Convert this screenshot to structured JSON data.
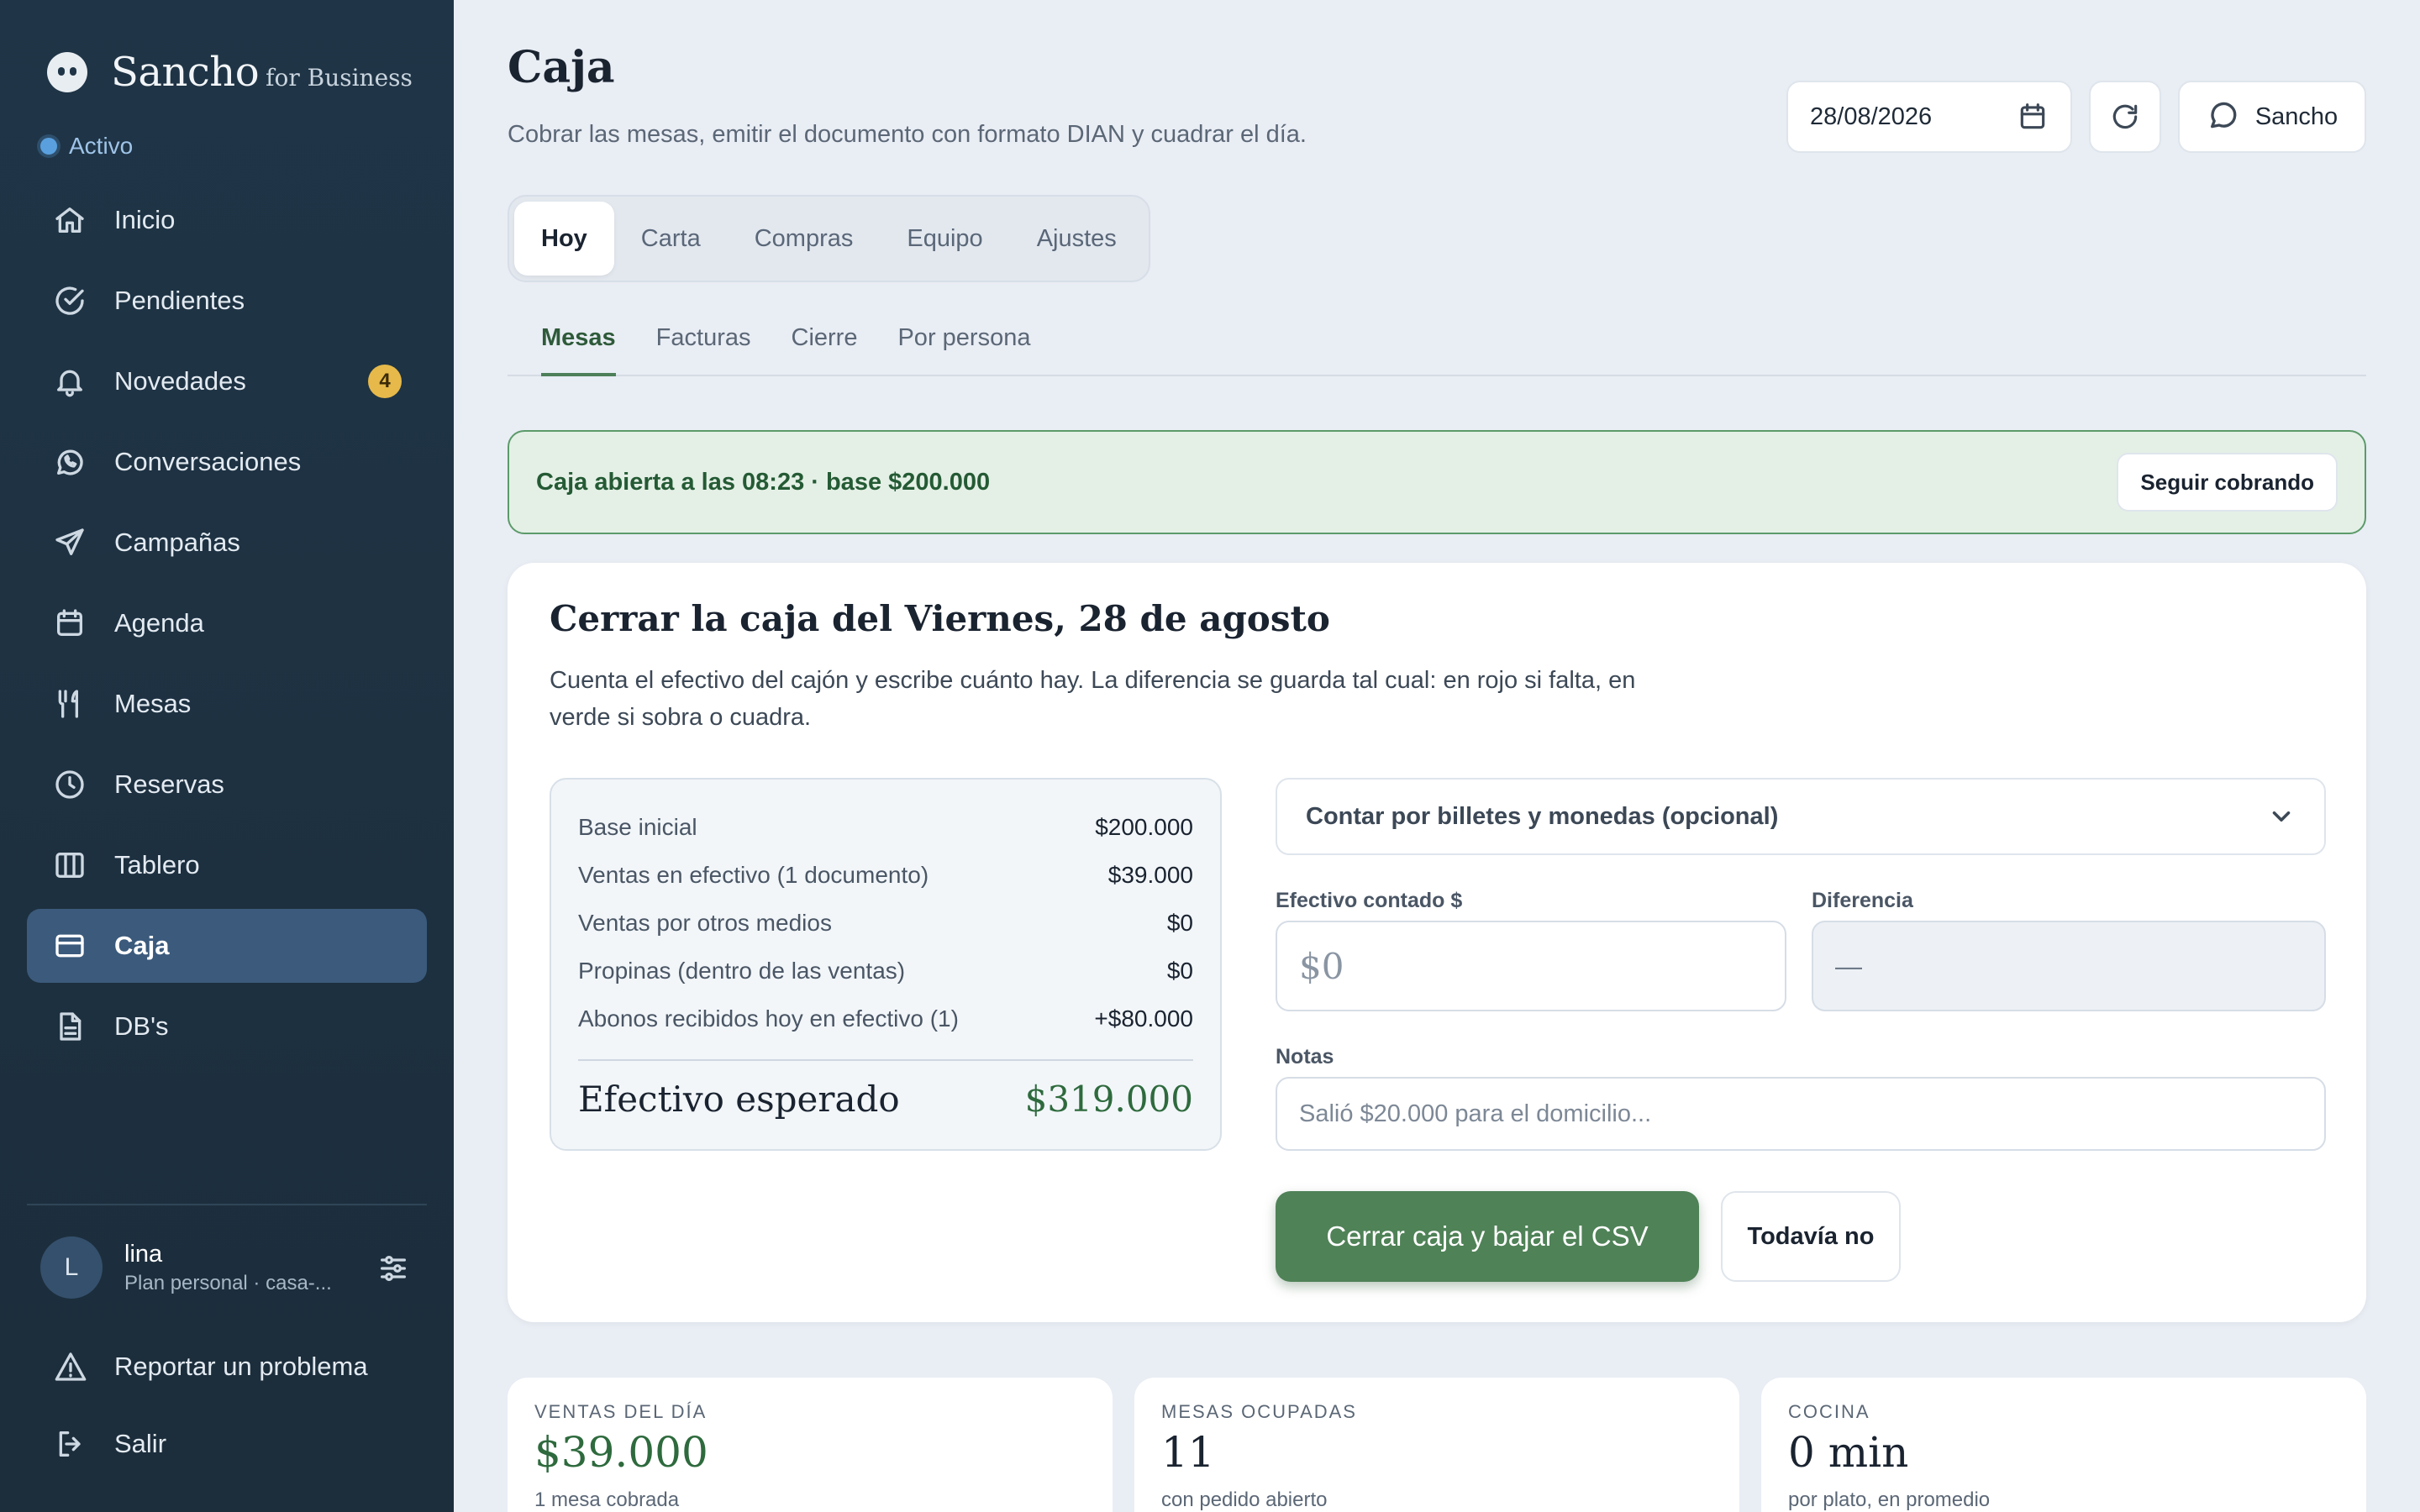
{
  "brand": {
    "name": "Sancho",
    "sub": "for Business",
    "status": "Activo"
  },
  "sidebar": {
    "items": [
      {
        "label": "Inicio",
        "icon": "home-icon"
      },
      {
        "label": "Pendientes",
        "icon": "check-circle-icon"
      },
      {
        "label": "Novedades",
        "icon": "bell-icon",
        "badge": "4"
      },
      {
        "label": "Conversaciones",
        "icon": "whatsapp-icon"
      },
      {
        "label": "Campañas",
        "icon": "send-icon"
      },
      {
        "label": "Agenda",
        "icon": "calendar-icon"
      },
      {
        "label": "Mesas",
        "icon": "utensils-icon"
      },
      {
        "label": "Reservas",
        "icon": "clock-icon"
      },
      {
        "label": "Tablero",
        "icon": "columns-icon"
      },
      {
        "label": "Caja",
        "icon": "credit-card-icon",
        "active": true
      },
      {
        "label": "DB's",
        "icon": "document-icon"
      }
    ],
    "user": {
      "initial": "L",
      "name": "lina",
      "plan": "Plan personal · casa-..."
    },
    "report": "Reportar un problema",
    "logout": "Salir"
  },
  "header": {
    "title": "Caja",
    "description": "Cobrar las mesas, emitir el documento con formato DIAN y cuadrar el día.",
    "date": "28/08/2026",
    "assistant_label": "Sancho"
  },
  "tabs": [
    "Hoy",
    "Carta",
    "Compras",
    "Equipo",
    "Ajustes"
  ],
  "subtabs": [
    "Mesas",
    "Facturas",
    "Cierre",
    "Por persona"
  ],
  "banner": {
    "text": "Caja abierta a las 08:23 · base $200.000",
    "button": "Seguir cobrando"
  },
  "close": {
    "title": "Cerrar la caja del Viernes, 28 de agosto",
    "description": "Cuenta el efectivo del cajón y escribe cuánto hay. La diferencia se guarda tal cual: en rojo si falta, en verde si sobra o cuadra.",
    "rows": [
      {
        "label": "Base inicial",
        "value": "$200.000"
      },
      {
        "label": "Ventas en efectivo (1 documento)",
        "value": "$39.000"
      },
      {
        "label": "Ventas por otros medios",
        "value": "$0"
      },
      {
        "label": "Propinas (dentro de las ventas)",
        "value": "$0"
      },
      {
        "label": "Abonos recibidos hoy en efectivo (1)",
        "value": "+$80.000"
      }
    ],
    "total_label": "Efectivo esperado",
    "total_value": "$319.000",
    "denominations": "Contar por billetes y monedas (opcional)",
    "cash_label": "Efectivo contado $",
    "cash_placeholder": "$0",
    "diff_label": "Diferencia",
    "diff_value": "—",
    "notes_label": "Notas",
    "notes_placeholder": "Salió $20.000 para el domicilio...",
    "primary_button": "Cerrar caja y bajar el CSV",
    "secondary_button": "Todavía no"
  },
  "stats": [
    {
      "label": "VENTAS DEL DÍA",
      "value": "$39.000",
      "sub": "1 mesa cobrada"
    },
    {
      "label": "MESAS OCUPADAS",
      "value": "11",
      "sub": "con pedido abierto"
    },
    {
      "label": "COCINA",
      "value": "0 min",
      "sub": "por plato, en promedio"
    }
  ],
  "colors": {
    "sidebar": "#1f3547",
    "accent": "#4f8257",
    "active_nav": "#3b5a7c",
    "badge": "#e6b94a"
  }
}
